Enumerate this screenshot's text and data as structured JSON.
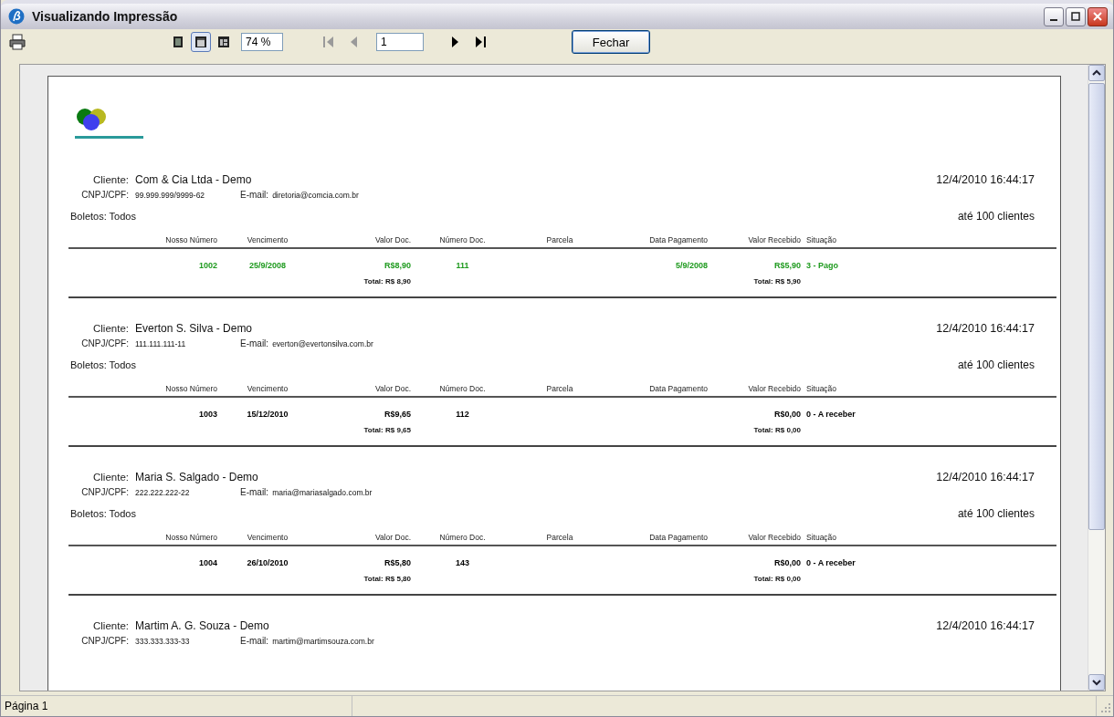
{
  "window": {
    "title": "Visualizando Impressão"
  },
  "toolbar": {
    "view_modes": [
      {
        "selected": false
      },
      {
        "selected": true
      },
      {
        "selected": false
      }
    ],
    "zoom": "74 %",
    "navigation": [
      {
        "kind": "first",
        "disabled": true
      },
      {
        "kind": "previous",
        "disabled": true
      },
      {
        "kind": "page",
        "value": "1"
      },
      {
        "kind": "next",
        "disabled": false
      },
      {
        "kind": "last",
        "disabled": false
      }
    ],
    "close_button": "Fechar"
  },
  "report": {
    "records": [
      {
        "client_label": "Cliente:",
        "client": "Com & Cia Ltda - Demo",
        "date": "12/4/2010 16:44:17",
        "cnpj_label": "CNPJ/CPF:",
        "cnpj": "99.999.999/9999-62",
        "email_label": "E-mail:",
        "email": "diretoria@comcia.com.br",
        "filter": "Boletos: Todos",
        "range": "até 100 clientes",
        "columns": [
          "Nosso Número",
          "Vencimento",
          "Valor Doc.",
          "Número Doc.",
          "Parcela",
          "Data Pagamento",
          "Valor Recebido",
          "Situação"
        ],
        "rows": [
          {
            "color": "#1e9a1e",
            "cells": {
              "nosso_numero": "1002",
              "vencimento": "25/9/2008",
              "valor_doc": "R$8,90",
              "numero_doc": "111",
              "data_pagamento": "5/9/2008",
              "valor_recebido": "R$5,90",
              "situacao": "3 - Pago"
            }
          }
        ],
        "totals": {
          "valor_doc": "Total: R$ 8,90",
          "valor_recebido": "Total: R$ 5,90"
        }
      },
      {
        "client_label": "Cliente:",
        "client": "Everton S. Silva - Demo",
        "date": "12/4/2010 16:44:17",
        "cnpj_label": "CNPJ/CPF:",
        "cnpj": "111.111.111-11",
        "email_label": "E-mail:",
        "email": "everton@evertonsilva.com.br",
        "filter": "Boletos: Todos",
        "range": "até 100 clientes",
        "columns": [
          "Nosso Número",
          "Vencimento",
          "Valor Doc.",
          "Número Doc.",
          "Parcela",
          "Data Pagamento",
          "Valor Recebido",
          "Situação"
        ],
        "rows": [
          {
            "color": "#000000",
            "cells": {
              "nosso_numero": "1003",
              "vencimento": "15/12/2010",
              "valor_doc": "R$9,65",
              "numero_doc": "112",
              "valor_recebido": "R$0,00",
              "situacao": "0 - A receber"
            }
          }
        ],
        "totals": {
          "valor_doc": "Total: R$ 9,65",
          "valor_recebido": "Total: R$ 0,00"
        }
      },
      {
        "client_label": "Cliente:",
        "client": "Maria S. Salgado - Demo",
        "date": "12/4/2010 16:44:17",
        "cnpj_label": "CNPJ/CPF:",
        "cnpj": "222.222.222-22",
        "email_label": "E-mail:",
        "email": "maria@mariasalgado.com.br",
        "filter": "Boletos: Todos",
        "range": "até 100 clientes",
        "columns": [
          "Nosso Número",
          "Vencimento",
          "Valor Doc.",
          "Número Doc.",
          "Parcela",
          "Data Pagamento",
          "Valor Recebido",
          "Situação"
        ],
        "rows": [
          {
            "color": "#000000",
            "cells": {
              "nosso_numero": "1004",
              "vencimento": "26/10/2010",
              "valor_doc": "R$5,80",
              "numero_doc": "143",
              "valor_recebido": "R$0,00",
              "situacao": "0 - A receber"
            }
          }
        ],
        "totals": {
          "valor_doc": "Total: R$ 5,80",
          "valor_recebido": "Total: R$ 0,00"
        }
      },
      {
        "client_label": "Cliente:",
        "client": "Martim A. G. Souza - Demo",
        "date": "12/4/2010 16:44:17",
        "cnpj_label": "CNPJ/CPF:",
        "cnpj": "333.333.333-33",
        "email_label": "E-mail:",
        "email": "martim@martimsouza.com.br"
      }
    ]
  },
  "status_bar": {
    "page": "Página 1"
  }
}
